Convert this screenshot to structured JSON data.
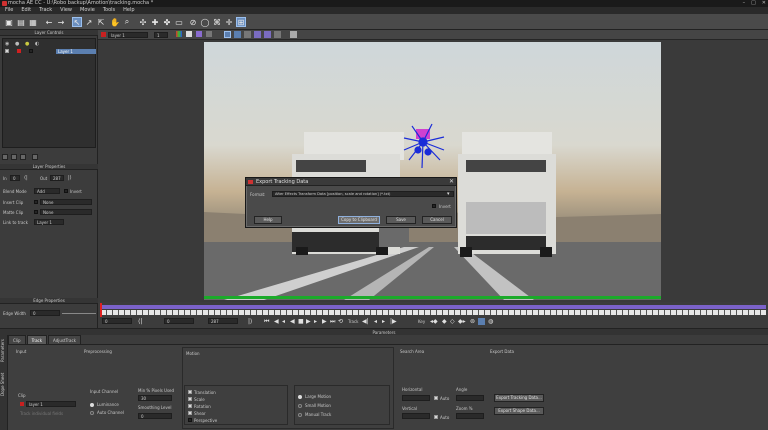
{
  "window": {
    "title": "mocha AE CC - U:\\Robo backup\\Amotion\\tracking.mocha *",
    "controls": [
      "–",
      "□",
      "✕"
    ]
  },
  "menu": [
    "File",
    "Edit",
    "Track",
    "View",
    "Movie",
    "Tools",
    "Help"
  ],
  "viewer_bar": {
    "layer_select": "layer 1",
    "view_num": "1"
  },
  "left": {
    "layer_controls_title": "Layer Controls",
    "layer_name": "Layer 1",
    "layer_props_title": "Layer Properties",
    "in_label": "In",
    "in_value": "0",
    "out_label": "Out",
    "out_value": "287",
    "blend_mode_label": "Blend Mode",
    "blend_mode_value": "Add",
    "invert_label": "Invert",
    "insert_clip_label": "Insert Clip",
    "insert_clip_value": "None",
    "matte_clip_label": "Matte Clip",
    "matte_clip_value": "None",
    "link_label": "Link to track",
    "link_value": "Layer 1",
    "edge_props_title": "Edge Properties",
    "edge_width_label": "Edge Width",
    "edge_width_value": "0"
  },
  "dialog": {
    "title": "Export Tracking Data",
    "format_label": "Format:",
    "format_value": "After Effects Transform Data [position, scale and rotation] (*.txt)",
    "invert_label": "Invert",
    "help_label": "Help",
    "copy_label": "Copy to Clipboard",
    "save_label": "Save",
    "cancel_label": "Cancel"
  },
  "timeline": {
    "start": "0",
    "end": "287",
    "current": "0",
    "track_label": "Track",
    "key_label": "Key"
  },
  "params": {
    "title": "Parameters",
    "vtab_params": "Parameters",
    "vtab_dope": "Dope Sheet",
    "tabs": [
      "Clip",
      "Track",
      "AdjustTrack"
    ],
    "active_tab": 1,
    "input_label": "Input",
    "clip_label": "Clip",
    "clip_value": "layer 1",
    "track_individual": "Track individual fields",
    "preprocessing_label": "Preprocessing",
    "input_channel_label": "Input Channel",
    "luminance_label": "Luminance",
    "auto_channel_label": "Auto Channel",
    "min_pixels_label": "Min % Pixels Used",
    "min_pixels_value": "30",
    "smoothing_label": "Smoothing Level",
    "smoothing_value": "0",
    "motion_label": "Motion",
    "motion_items": [
      "Translation",
      "Scale",
      "Rotation",
      "Shear",
      "Perspective"
    ],
    "motion_checked": [
      true,
      true,
      true,
      true,
      false
    ],
    "motion_right": [
      "Large Motion",
      "Small Motion",
      "Manual Track"
    ],
    "search_area_label": "Search Area",
    "horizontal_label": "Horizontal",
    "vertical_label": "Vertical",
    "auto_label": "Auto",
    "angle_label": "Angle",
    "zoom_label": "Zoom %",
    "export_data_label": "Export Data",
    "export_tracking_label": "Export Tracking Data...",
    "export_shape_label": "Export Shape Data..."
  },
  "colors": {
    "selected_blue": "#5b7fb0",
    "timeline_purple": "#7b62c9",
    "timeline_green": "#1bab2a",
    "track_points": "#1a2cd8"
  }
}
